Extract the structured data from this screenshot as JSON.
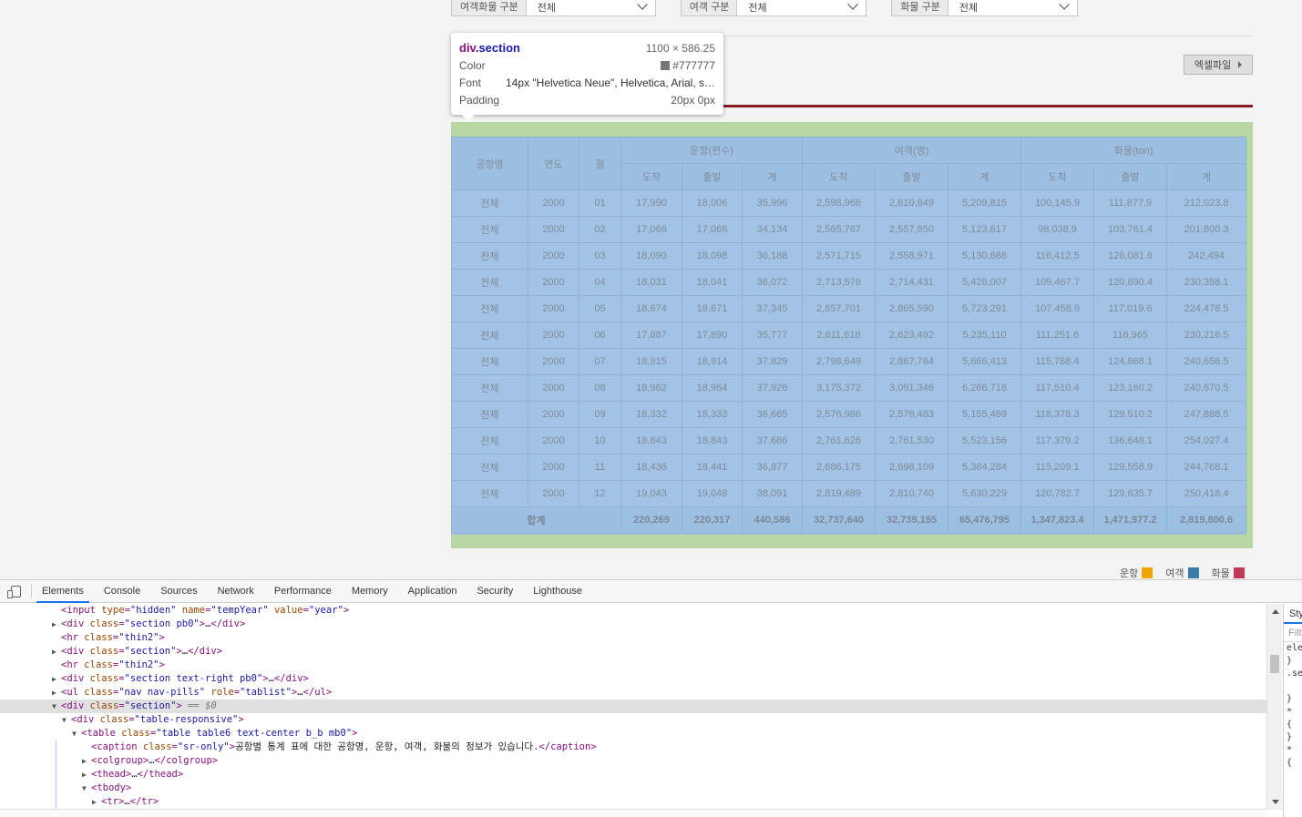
{
  "filters": [
    {
      "label": "여객화물 구분",
      "value": "전체"
    },
    {
      "label": "여객 구분",
      "value": "전체"
    },
    {
      "label": "화물 구분",
      "value": "전체"
    }
  ],
  "excel_button": "엑셀파일",
  "tooltip": {
    "tag": "div",
    "cls": ".section",
    "size": "1100 × 586.25",
    "color_label": "Color",
    "color_value": "#777777",
    "font_label": "Font",
    "font_value": "14px \"Helvetica Neue\", Helvetica, Arial, s…",
    "padding_label": "Padding",
    "padding_value": "20px 0px"
  },
  "table": {
    "headers": {
      "airport": "공항명",
      "year": "연도",
      "month": "월",
      "flights": "운항(편수)",
      "passengers": "여객(명)",
      "cargo": "화물(ton)",
      "arrive": "도착",
      "depart": "출발",
      "total": "계"
    },
    "rows": [
      [
        "전체",
        "2000",
        "01",
        "17,990",
        "18,006",
        "35,996",
        "2,598,966",
        "2,610,849",
        "5,209,815",
        "100,145.9",
        "111,877.9",
        "212,023.8"
      ],
      [
        "전체",
        "2000",
        "02",
        "17,066",
        "17,068",
        "34,134",
        "2,565,767",
        "2,557,850",
        "5,123,617",
        "98,038.9",
        "103,761.4",
        "201,800.3"
      ],
      [
        "전체",
        "2000",
        "03",
        "18,090",
        "18,098",
        "36,188",
        "2,571,715",
        "2,558,971",
        "5,130,686",
        "116,412.5",
        "126,081.6",
        "242,494"
      ],
      [
        "전체",
        "2000",
        "04",
        "18,031",
        "18,041",
        "36,072",
        "2,713,576",
        "2,714,431",
        "5,428,007",
        "109,467.7",
        "120,890.4",
        "230,358.1"
      ],
      [
        "전체",
        "2000",
        "05",
        "18,674",
        "18,671",
        "37,345",
        "2,857,701",
        "2,865,590",
        "5,723,291",
        "107,458.9",
        "117,019.6",
        "224,478.5"
      ],
      [
        "전체",
        "2000",
        "06",
        "17,887",
        "17,890",
        "35,777",
        "2,611,618",
        "2,623,492",
        "5,235,110",
        "111,251.6",
        "118,965",
        "230,216.5"
      ],
      [
        "전체",
        "2000",
        "07",
        "18,915",
        "18,914",
        "37,829",
        "2,798,649",
        "2,867,764",
        "5,666,413",
        "115,788.4",
        "124,868.1",
        "240,656.5"
      ],
      [
        "전체",
        "2000",
        "08",
        "18,962",
        "18,964",
        "37,926",
        "3,175,372",
        "3,091,346",
        "6,266,718",
        "117,510.4",
        "123,160.2",
        "240,670.5"
      ],
      [
        "전체",
        "2000",
        "09",
        "18,332",
        "18,333",
        "36,665",
        "2,576,986",
        "2,578,483",
        "5,155,469",
        "118,378.3",
        "129,510.2",
        "247,888.5"
      ],
      [
        "전체",
        "2000",
        "10",
        "18,843",
        "18,843",
        "37,686",
        "2,761,626",
        "2,761,530",
        "5,523,156",
        "117,379.2",
        "136,648.1",
        "254,027.4"
      ],
      [
        "전체",
        "2000",
        "11",
        "18,436",
        "18,441",
        "36,877",
        "2,686,175",
        "2,698,109",
        "5,384,284",
        "115,209.1",
        "129,558.9",
        "244,768.1"
      ],
      [
        "전체",
        "2000",
        "12",
        "19,043",
        "19,048",
        "38,091",
        "2,819,489",
        "2,810,740",
        "5,630,229",
        "120,782.7",
        "129,635.7",
        "250,418.4"
      ]
    ],
    "total_label": "합계",
    "totals": [
      "220,269",
      "220,317",
      "440,586",
      "32,737,640",
      "32,739,155",
      "65,476,795",
      "1,347,823.4",
      "1,471,977.2",
      "2,819,800.6"
    ]
  },
  "legend": [
    {
      "label": "운항",
      "color": "#f0a500"
    },
    {
      "label": "여객",
      "color": "#3a7ca5"
    },
    {
      "label": "화물",
      "color": "#c0395a"
    }
  ],
  "devtools": {
    "tabs": [
      "Elements",
      "Console",
      "Sources",
      "Network",
      "Performance",
      "Memory",
      "Application",
      "Security",
      "Lighthouse"
    ],
    "active_tab": "Elements",
    "styles_tab": "Sty",
    "styles_filter": "Filt",
    "styles_lines": [
      "ele",
      "}",
      ".se",
      "",
      "}",
      "* {",
      "",
      "}",
      "* {",
      "",
      ""
    ],
    "code": [
      {
        "indent": 0,
        "arrow": "",
        "html": "<span class=\"tag\">&lt;input </span><span class=\"an\">type</span>=<span class=\"av\">\"hidden\"</span> <span class=\"an\">name</span>=<span class=\"av\">\"tempYear\"</span> <span class=\"an\">value</span>=<span class=\"av\">\"year\"</span><span class=\"tag\">&gt;</span>"
      },
      {
        "indent": 0,
        "arrow": "▶",
        "html": "<span class=\"tag\">&lt;div </span><span class=\"an\">class</span>=<span class=\"av\">\"section pb0\"</span><span class=\"tag\">&gt;</span><span class=\"txt\">…</span><span class=\"tag\">&lt;/div&gt;</span>"
      },
      {
        "indent": 0,
        "arrow": "",
        "html": "<span class=\"tag\">&lt;hr </span><span class=\"an\">class</span>=<span class=\"av\">\"thin2\"</span><span class=\"tag\">&gt;</span>"
      },
      {
        "indent": 0,
        "arrow": "▶",
        "html": "<span class=\"tag\">&lt;div </span><span class=\"an\">class</span>=<span class=\"av\">\"section\"</span><span class=\"tag\">&gt;</span><span class=\"txt\">…</span><span class=\"tag\">&lt;/div&gt;</span>"
      },
      {
        "indent": 0,
        "arrow": "",
        "html": "<span class=\"tag\">&lt;hr </span><span class=\"an\">class</span>=<span class=\"av\">\"thin2\"</span><span class=\"tag\">&gt;</span>"
      },
      {
        "indent": 0,
        "arrow": "▶",
        "html": "<span class=\"tag\">&lt;div </span><span class=\"an\">class</span>=<span class=\"av\">\"section text-right pb0\"</span><span class=\"tag\">&gt;</span><span class=\"txt\">…</span><span class=\"tag\">&lt;/div&gt;</span>"
      },
      {
        "indent": 0,
        "arrow": "▶",
        "html": "<span class=\"tag\">&lt;ul </span><span class=\"an\">class</span>=<span class=\"av\">\"nav nav-pills\"</span> <span class=\"an\">role</span>=<span class=\"av\">\"tablist\"</span><span class=\"tag\">&gt;</span><span class=\"txt\">…</span><span class=\"tag\">&lt;/ul&gt;</span>"
      },
      {
        "indent": 0,
        "arrow": "▼",
        "sel": true,
        "html": "<span class=\"tag\">&lt;div </span><span class=\"an\">class</span>=<span class=\"av\">\"section\"</span><span class=\"tag\">&gt;</span> <span class=\"dollar\">== $0</span>"
      },
      {
        "indent": 1,
        "arrow": "▼",
        "html": "<span class=\"tag\">&lt;div </span><span class=\"an\">class</span>=<span class=\"av\">\"table-responsive\"</span><span class=\"tag\">&gt;</span>"
      },
      {
        "indent": 2,
        "arrow": "▼",
        "html": "<span class=\"tag\">&lt;table </span><span class=\"an\">class</span>=<span class=\"av\">\"table table6 text-center b_b mb0\"</span><span class=\"tag\">&gt;</span>"
      },
      {
        "indent": 3,
        "arrow": "",
        "html": "<span class=\"tag\">&lt;caption </span><span class=\"an\">class</span>=<span class=\"av\">\"sr-only\"</span><span class=\"tag\">&gt;</span><span class=\"txt\">공항별 통계 표에 대한 공항명, 운항, 여객, 화물의 정보가 있습니다.</span><span class=\"tag\">&lt;/caption&gt;</span>"
      },
      {
        "indent": 3,
        "arrow": "▶",
        "html": "<span class=\"tag\">&lt;colgroup&gt;</span><span class=\"txt\">…</span><span class=\"tag\">&lt;/colgroup&gt;</span>"
      },
      {
        "indent": 3,
        "arrow": "▶",
        "html": "<span class=\"tag\">&lt;thead&gt;</span><span class=\"txt\">…</span><span class=\"tag\">&lt;/thead&gt;</span>"
      },
      {
        "indent": 3,
        "arrow": "▼",
        "html": "<span class=\"tag\">&lt;tbody&gt;</span>"
      },
      {
        "indent": 4,
        "arrow": "▶",
        "html": "<span class=\"tag\">&lt;tr&gt;</span><span class=\"txt\">…</span><span class=\"tag\">&lt;/tr&gt;</span>"
      }
    ]
  }
}
